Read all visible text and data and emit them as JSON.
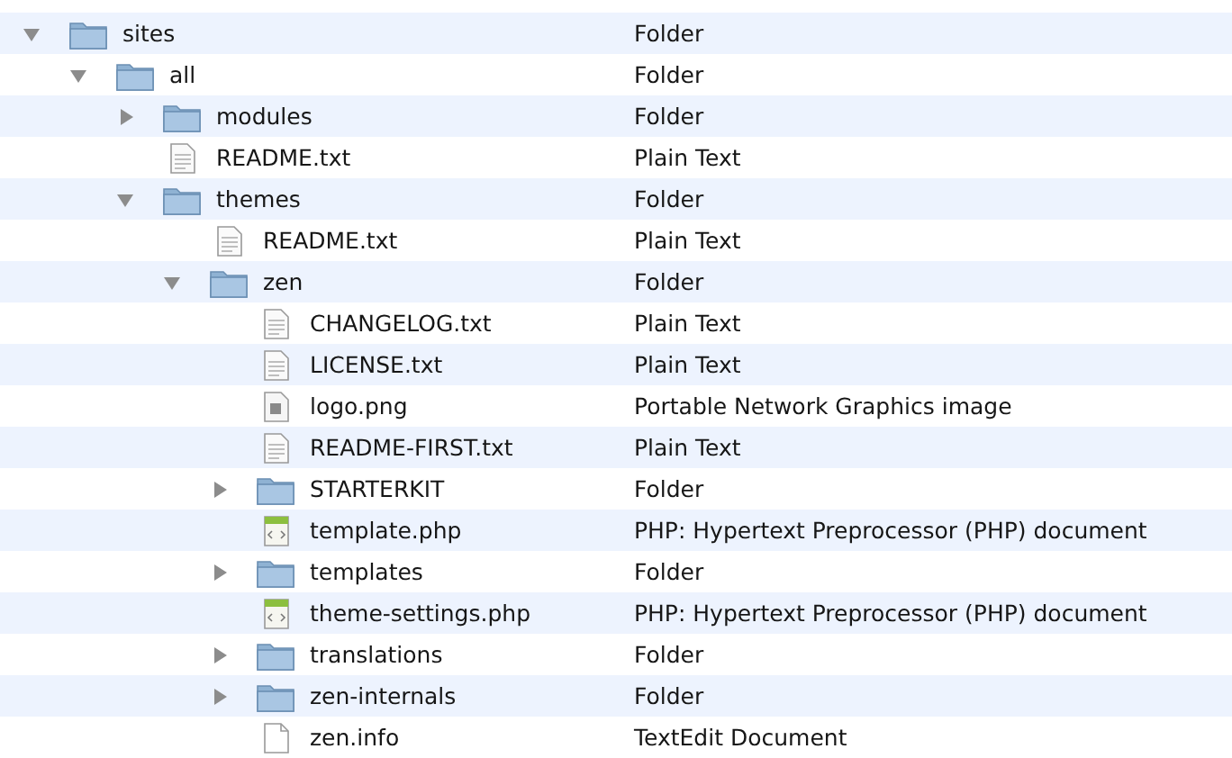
{
  "tree": [
    {
      "name": "sites",
      "file_type": "Folder",
      "kind": "folder",
      "expanded": true,
      "children": [
        {
          "name": "all",
          "file_type": "Folder",
          "kind": "folder",
          "expanded": true,
          "children": [
            {
              "name": "modules",
              "file_type": "Folder",
              "kind": "folder",
              "expanded": false
            },
            {
              "name": "README.txt",
              "file_type": "Plain Text",
              "kind": "text"
            },
            {
              "name": "themes",
              "file_type": "Folder",
              "kind": "folder",
              "expanded": true,
              "children": [
                {
                  "name": "README.txt",
                  "file_type": "Plain Text",
                  "kind": "text"
                },
                {
                  "name": "zen",
                  "file_type": "Folder",
                  "kind": "folder",
                  "expanded": true,
                  "children": [
                    {
                      "name": "CHANGELOG.txt",
                      "file_type": "Plain Text",
                      "kind": "text"
                    },
                    {
                      "name": "LICENSE.txt",
                      "file_type": "Plain Text",
                      "kind": "text"
                    },
                    {
                      "name": "logo.png",
                      "file_type": "Portable Network Graphics image",
                      "kind": "image"
                    },
                    {
                      "name": "README-FIRST.txt",
                      "file_type": "Plain Text",
                      "kind": "text"
                    },
                    {
                      "name": "STARTERKIT",
                      "file_type": "Folder",
                      "kind": "folder",
                      "expanded": false
                    },
                    {
                      "name": "template.php",
                      "file_type": "PHP: Hypertext Preprocessor (PHP) document",
                      "kind": "php"
                    },
                    {
                      "name": "templates",
                      "file_type": "Folder",
                      "kind": "folder",
                      "expanded": false
                    },
                    {
                      "name": "theme-settings.php",
                      "file_type": "PHP: Hypertext Preprocessor (PHP) document",
                      "kind": "php"
                    },
                    {
                      "name": "translations",
                      "file_type": "Folder",
                      "kind": "folder",
                      "expanded": false
                    },
                    {
                      "name": "zen-internals",
                      "file_type": "Folder",
                      "kind": "folder",
                      "expanded": false
                    },
                    {
                      "name": "zen.info",
                      "file_type": "TextEdit Document",
                      "kind": "document"
                    }
                  ]
                }
              ]
            }
          ]
        }
      ]
    }
  ]
}
